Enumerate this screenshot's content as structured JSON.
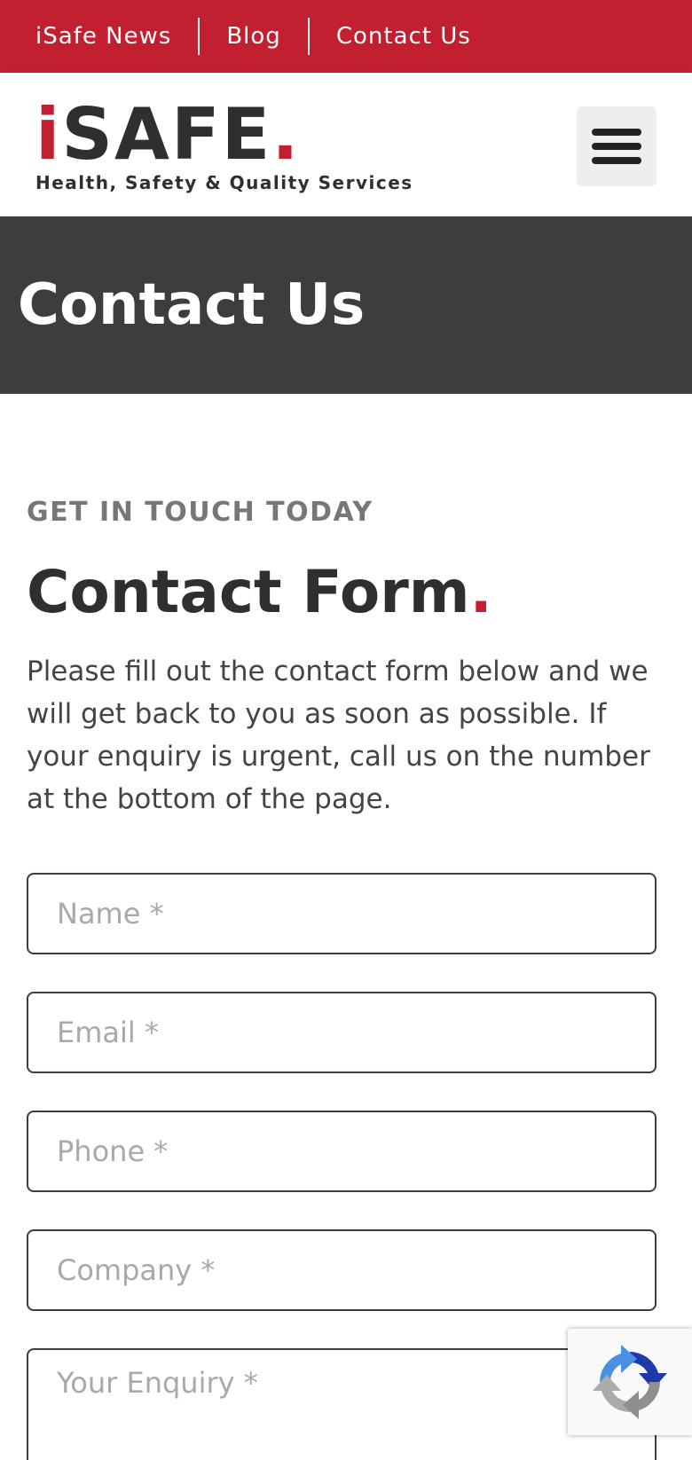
{
  "topbar": {
    "links": [
      "iSafe News",
      "Blog",
      "Contact Us"
    ],
    "background": "#c21f31"
  },
  "header": {
    "logo": {
      "first_letter": "i",
      "rest": "SAFE",
      "dot": ".",
      "tagline": "Health, Safety & Quality Services"
    },
    "menu_icon": "hamburger-menu-icon"
  },
  "banner": {
    "title": "Contact Us",
    "background": "#3d3d3d"
  },
  "content": {
    "eyebrow": "GET IN TOUCH TODAY",
    "title": "Contact Form",
    "title_dot": ".",
    "intro": "Please fill out the contact form below and we will get back to you as soon as possible. If your enquiry is urgent, call us on the number at the bottom of the page."
  },
  "form": {
    "name_placeholder": "Name *",
    "email_placeholder": "Email *",
    "phone_placeholder": "Phone *",
    "company_placeholder": "Company *",
    "enquiry_placeholder": "Your Enquiry *"
  },
  "recaptcha_icon": "recaptcha-icon",
  "accent_color": "#c21f31"
}
